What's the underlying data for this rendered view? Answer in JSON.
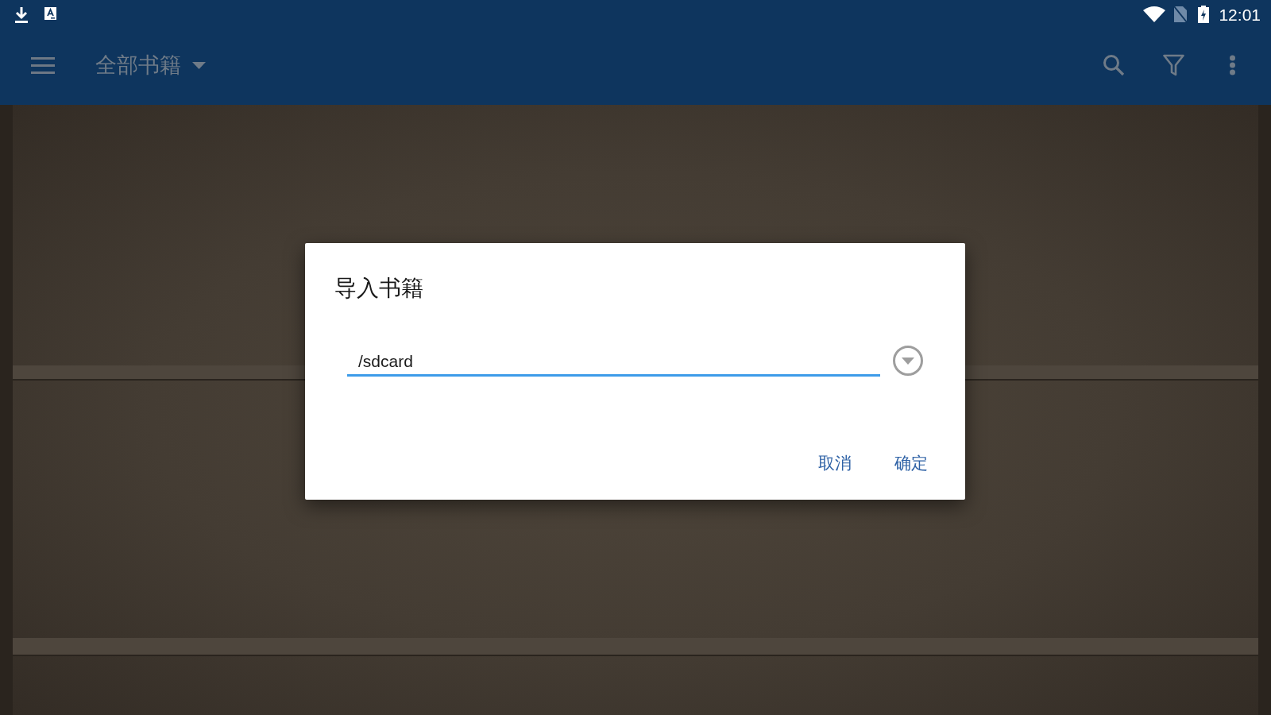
{
  "status_bar": {
    "time": "12:01"
  },
  "app_bar": {
    "title": "全部书籍"
  },
  "dialog": {
    "title": "导入书籍",
    "path_field": {
      "value": "/sdcard"
    },
    "buttons": [
      "取消",
      "确定"
    ]
  }
}
